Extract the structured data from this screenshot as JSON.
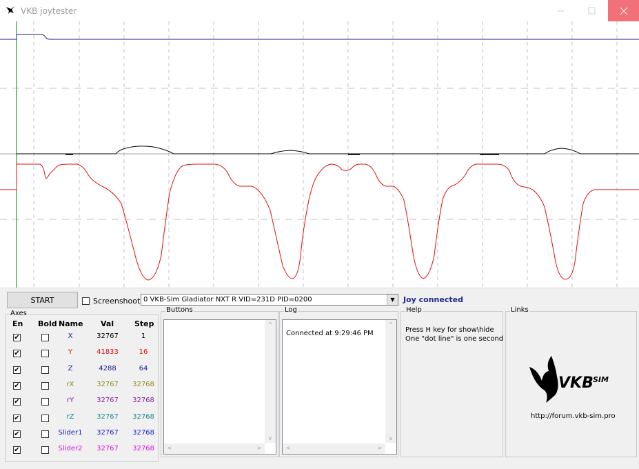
{
  "window": {
    "title": "VKB joytester"
  },
  "toolbar": {
    "start_label": "START",
    "screenshot_label": "Screenshoot",
    "screenshot_checked": false,
    "device_selected": "0  VKB-Sim Gladiator NXT R   VID=231D PID=0200",
    "status": "Joy connected"
  },
  "axes_group": {
    "title": "Axes",
    "headers": {
      "en": "En",
      "bold": "Bold",
      "name": "Name",
      "val": "Val",
      "step": "Step"
    },
    "rows": [
      {
        "enabled": true,
        "bold": false,
        "name": "X",
        "val": "32767",
        "step": "1",
        "color": "#1a1a8c"
      },
      {
        "enabled": true,
        "bold": false,
        "name": "Y",
        "val": "41833",
        "step": "16",
        "color": "#e01010"
      },
      {
        "enabled": true,
        "bold": false,
        "name": "Z",
        "val": "4288",
        "step": "64",
        "color": "#1a1a8c"
      },
      {
        "enabled": true,
        "bold": false,
        "name": "rX",
        "val": "32767",
        "step": "32768",
        "color": "#8a8a1a"
      },
      {
        "enabled": true,
        "bold": false,
        "name": "rY",
        "val": "32767",
        "step": "32768",
        "color": "#8a1a9a"
      },
      {
        "enabled": true,
        "bold": false,
        "name": "rZ",
        "val": "32767",
        "step": "32768",
        "color": "#1a8a8a"
      },
      {
        "enabled": true,
        "bold": false,
        "name": "Slider1",
        "val": "32767",
        "step": "32768",
        "color": "#1a1ad0"
      },
      {
        "enabled": true,
        "bold": false,
        "name": "Slider2",
        "val": "32767",
        "step": "32768",
        "color": "#e010e0"
      }
    ]
  },
  "buttons_group": {
    "title": "Buttons"
  },
  "log_group": {
    "title": "Log",
    "entries": [
      "Connected at 9:29:46 PM"
    ]
  },
  "help_group": {
    "title": "Help",
    "lines": [
      "Press H key for show\\hide",
      "One \"dot line\" is one second"
    ]
  },
  "links_group": {
    "title": "Links",
    "logo_text": "VKBSIM",
    "url": "http://forum.vkb-sim.pro"
  },
  "colors": {
    "blue_trace": "#1a1a8c",
    "red_trace": "#e01010",
    "black_trace": "#000000",
    "start_marker": "#008000",
    "close_button": "#f1707a"
  },
  "icons": {
    "app": "vkb-logo-icon",
    "dropdown": "chevron-down-icon"
  }
}
